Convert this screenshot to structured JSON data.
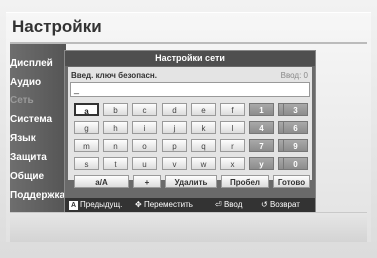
{
  "page": {
    "title": "Настройки"
  },
  "menu": {
    "items": [
      {
        "label": "Дисплей"
      },
      {
        "label": "Аудио"
      },
      {
        "label": "Сеть"
      },
      {
        "label": "Система"
      },
      {
        "label": "Язык"
      },
      {
        "label": "Защита"
      },
      {
        "label": "Общие"
      },
      {
        "label": "Поддержка"
      }
    ]
  },
  "dialog": {
    "title": "Настройки сети",
    "field_label": "Введ. ключ безопасн.",
    "field_count": "Ввод: 0",
    "field_value": "_",
    "keys": {
      "a": "a",
      "b": "b",
      "c": "c",
      "d": "d",
      "e": "e",
      "f": "f",
      "g": "g",
      "h": "h",
      "i": "i",
      "j": "j",
      "k": "k",
      "l": "l",
      "m": "m",
      "n": "n",
      "o": "o",
      "p": "p",
      "q": "q",
      "r": "r",
      "s": "s",
      "t": "t",
      "u": "u",
      "v": "v",
      "w": "w",
      "x": "x",
      "y": "y",
      "z": "z",
      "n1": "1",
      "n2": "2",
      "n3": "3",
      "n4": "4",
      "n5": "5",
      "n6": "6",
      "n7": "7",
      "n8": "8",
      "n9": "9",
      "n0": "0",
      "case": "a/A",
      "plus": "+",
      "delete": "Удалить",
      "space": "Пробел",
      "done": "Готово"
    },
    "footer": {
      "prev_key": "A",
      "prev": "Предыдущ.",
      "move": "Переместить",
      "enter": "Ввод",
      "back": "Возврат"
    }
  }
}
